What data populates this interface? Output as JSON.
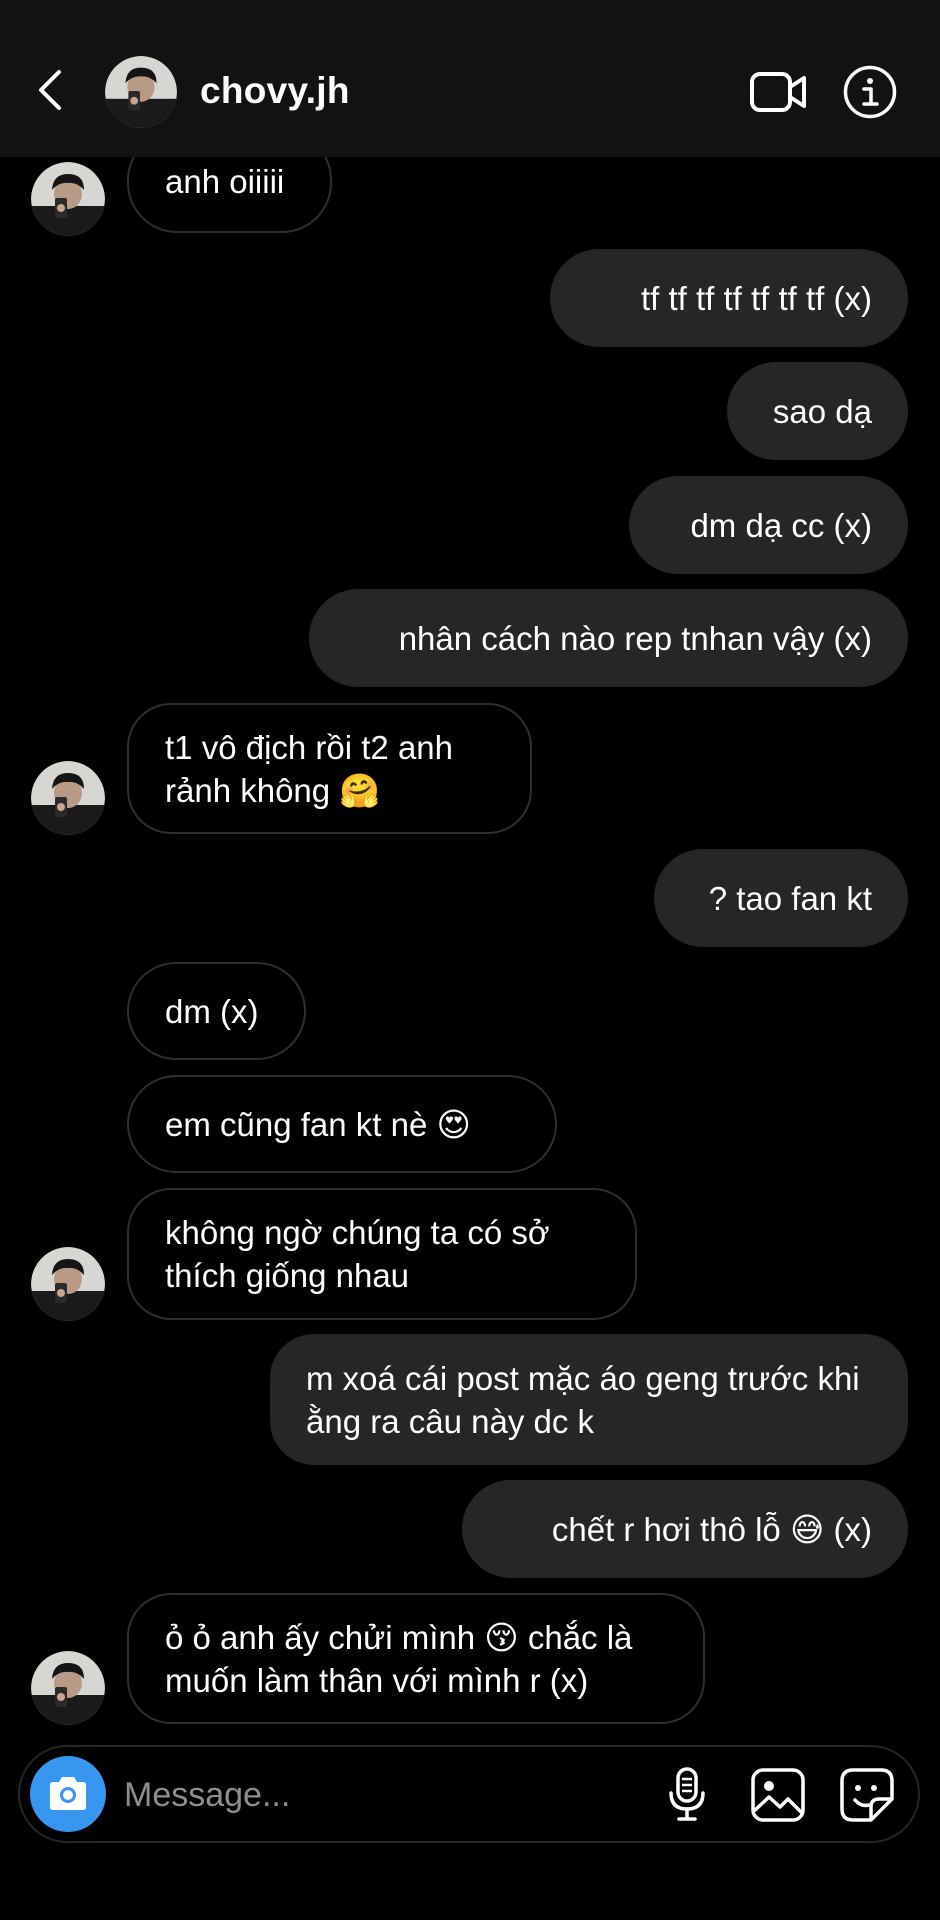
{
  "header": {
    "username": "chovy.jh",
    "back_icon": "chevron-left-icon",
    "video_icon": "video-camera-icon",
    "info_icon": "info-icon"
  },
  "messages": [
    {
      "side": "in",
      "text": "anh oiiiii"
    },
    {
      "side": "out",
      "text": "tf tf tf tf tf tf tf (x)"
    },
    {
      "side": "out",
      "text": "sao dạ"
    },
    {
      "side": "out",
      "text": "dm dạ cc (x)"
    },
    {
      "side": "out",
      "text": "nhân cách nào rep tnhan vậy (x)"
    },
    {
      "side": "in",
      "text": "t1 vô địch rồi t2 anh rảnh không 🤗"
    },
    {
      "side": "out",
      "text": "? tao fan kt"
    },
    {
      "side": "in",
      "text": "dm (x)"
    },
    {
      "side": "in",
      "text": "em cũng fan kt nè 😍"
    },
    {
      "side": "in",
      "text": "không ngờ chúng ta có sở thích giống nhau"
    },
    {
      "side": "out",
      "text": "m xoá cái post mặc áo geng trước khi ằng ra câu này dc k"
    },
    {
      "side": "out",
      "text": "chết r hơi thô lỗ 😅 (x)"
    },
    {
      "side": "in",
      "text": "ỏ ỏ anh ấy chửi mình 😚 chắc là muốn làm thân với mình r (x)"
    }
  ],
  "composer": {
    "placeholder": "Message...",
    "camera_icon": "camera-icon",
    "mic_icon": "microphone-icon",
    "gallery_icon": "image-gallery-icon",
    "sticker_icon": "sticker-icon",
    "camera_color": "#3797f0"
  },
  "colors": {
    "background": "#000000",
    "header": "#121212",
    "outgoing_bubble": "#262626",
    "incoming_border": "#2f2f2f",
    "placeholder": "#8e8e8e"
  }
}
